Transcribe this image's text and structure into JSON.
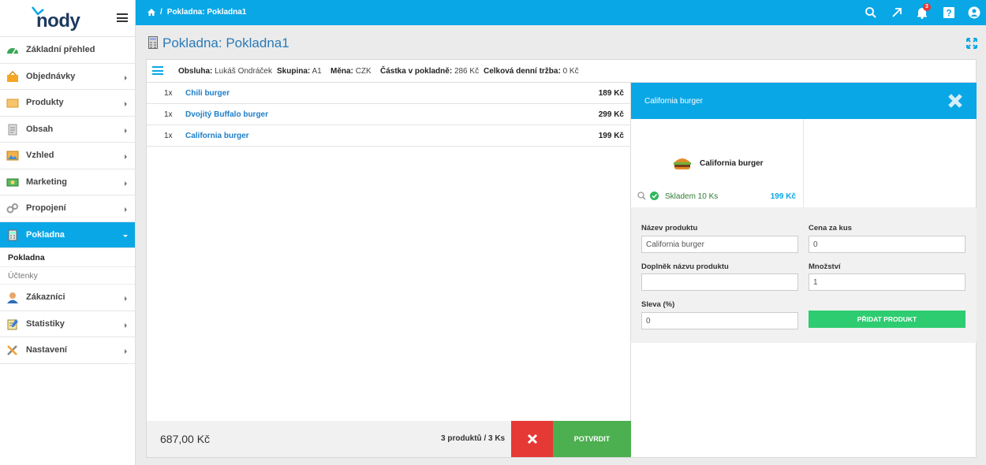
{
  "brand": {
    "logo_text": "nody"
  },
  "sidebar": {
    "items": [
      {
        "label": "Základní přehled",
        "icon": "dashboard-icon"
      },
      {
        "label": "Objednávky",
        "icon": "basket-icon"
      },
      {
        "label": "Produkty",
        "icon": "box-icon"
      },
      {
        "label": "Obsah",
        "icon": "document-icon"
      },
      {
        "label": "Vzhled",
        "icon": "image-icon"
      },
      {
        "label": "Marketing",
        "icon": "money-icon"
      },
      {
        "label": "Propojení",
        "icon": "gears-icon"
      },
      {
        "label": "Pokladna",
        "icon": "calculator-icon"
      },
      {
        "label": "Zákazníci",
        "icon": "user-icon"
      },
      {
        "label": "Statistiky",
        "icon": "notepad-icon"
      },
      {
        "label": "Nastavení",
        "icon": "tools-icon"
      }
    ],
    "sub_items": [
      {
        "label": "Pokladna"
      },
      {
        "label": "Účtenky"
      }
    ]
  },
  "topbar": {
    "breadcrumb_sep": "/",
    "breadcrumb": "Pokladna: Pokladna1",
    "notifications_count": "3"
  },
  "page": {
    "title": "Pokladna: Pokladna1"
  },
  "info": {
    "operator_label": "Obsluha:",
    "operator": "Lukáš Ondráček",
    "group_label": "Skupina:",
    "group": "A1",
    "currency_label": "Měna:",
    "currency": "CZK",
    "cash_label": "Částka v pokladně:",
    "cash": "286 Kč",
    "daily_label": "Celková denní tržba:",
    "daily": "0 Kč"
  },
  "cart": {
    "items": [
      {
        "qty": "1x",
        "name": "Chili burger",
        "price": "189 Kč"
      },
      {
        "qty": "1x",
        "name": "Dvojitý Buffalo burger",
        "price": "299 Kč"
      },
      {
        "qty": "1x",
        "name": "California burger",
        "price": "199 Kč"
      }
    ],
    "total": "687,00 Kč",
    "count": "3 produktů / 3 Ks",
    "confirm_label": "POTVRDIT"
  },
  "detail": {
    "title": "California burger",
    "product_name": "California burger",
    "stock": "Skladem 10 Ks",
    "price": "199 Kč",
    "form": {
      "name_label": "Název produktu",
      "name_value": "California burger",
      "unit_price_label": "Cena za kus",
      "unit_price_value": "0",
      "suffix_label": "Doplněk názvu produktu",
      "suffix_value": "",
      "qty_label": "Množství",
      "qty_value": "1",
      "discount_label": "Sleva (%)",
      "discount_value": "0",
      "add_label": "PŘIDAT PRODUKT"
    }
  },
  "colors": {
    "accent": "#0aa7e6",
    "danger": "#e53935",
    "success": "#4caf50"
  }
}
